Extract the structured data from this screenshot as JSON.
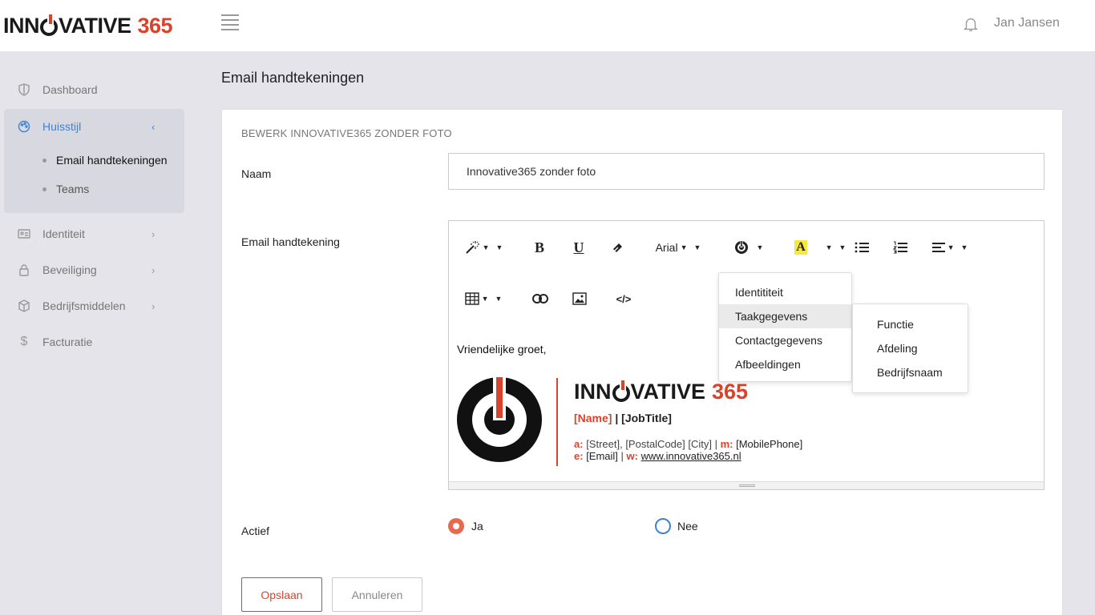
{
  "brand": {
    "logo_left": "INN",
    "logo_right": "VATIVE",
    "logo_number": "365",
    "accent_color": "#d9432b"
  },
  "header": {
    "user_name": "Jan Jansen"
  },
  "sidebar": {
    "items": [
      {
        "label": "Dashboard",
        "icon": "shield-icon"
      },
      {
        "label": "Huisstijl",
        "icon": "palette-icon"
      },
      {
        "label": "Identiteit",
        "icon": "id-card-icon"
      },
      {
        "label": "Beveiliging",
        "icon": "lock-icon"
      },
      {
        "label": "Bedrijfsmiddelen",
        "icon": "box-icon"
      },
      {
        "label": "Facturatie",
        "icon": "dollar-icon"
      }
    ],
    "sub_items": [
      {
        "label": "Email handtekeningen"
      },
      {
        "label": "Teams"
      }
    ]
  },
  "page": {
    "title": "Email handtekeningen"
  },
  "form": {
    "card_title": "BEWERK INNOVATIVE365 ZONDER FOTO",
    "naam_label": "Naam",
    "naam_value": "Innovative365 zonder foto",
    "signature_label": "Email handtekening",
    "actief_label": "Actief",
    "radio_yes": "Ja",
    "radio_no": "Nee",
    "save_label": "Opslaan",
    "cancel_label": "Annuleren"
  },
  "editor": {
    "font_name": "Arial",
    "greeting": "Vriendelijke groet,",
    "signature": {
      "brand_left": "INN",
      "brand_right": "VATIVE",
      "brand_number": "365",
      "name": "[Name]",
      "separator": " | ",
      "jobtitle": "[JobTitle]",
      "a_label": "a:",
      "address": "[Street], [PostalCode] [City]",
      "pipe": " | ",
      "m_label": "m:",
      "mobile": "[MobilePhone]",
      "e_label": "e:",
      "email": "[Email]",
      "w_label": "w:",
      "website": "www.innovative365.nl"
    }
  },
  "dropdown": {
    "items": [
      "Identititeit",
      "Taakgegevens",
      "Contactgegevens",
      "Afbeeldingen"
    ],
    "highlighted": "Taakgegevens",
    "submenu": [
      "Functie",
      "Afdeling",
      "Bedrijfsnaam"
    ]
  }
}
